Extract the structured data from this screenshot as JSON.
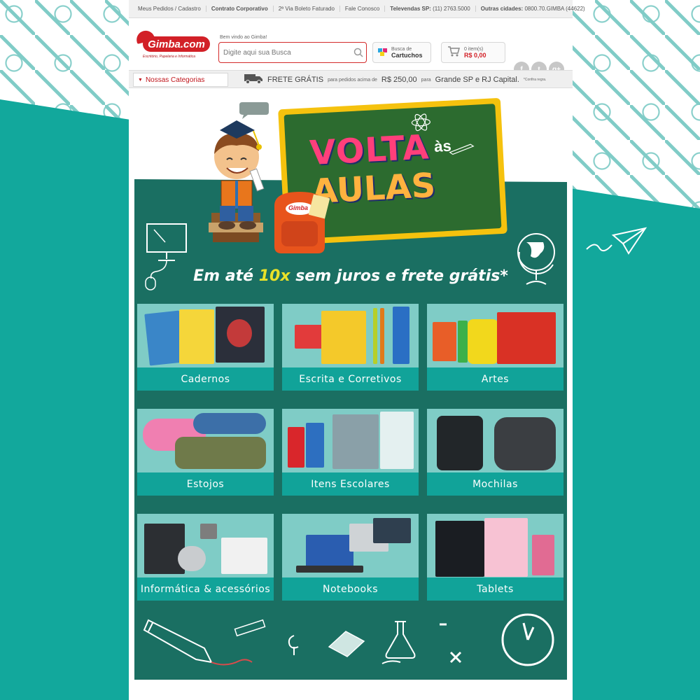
{
  "topbar": {
    "links": [
      "Meus Pedidos / Cadastro",
      "Contrato Corporativo",
      "2ª Via Boleto Faturado",
      "Fale Conosco"
    ],
    "televendas_label": "Televendas SP:",
    "televendas_number": "(11) 2763.5000",
    "outras_label": "Outras cidades:",
    "outras_number": "0800.70.GIMBA (44622)"
  },
  "header": {
    "logo_text": "Gimba.com",
    "logo_sub": "Escritório, Papelaria e Informática",
    "welcome": "Bem vindo ao Gimba!",
    "search_placeholder": "Digite aqui sua Busca",
    "cartridge_line1": "Busca de",
    "cartridge_line2": "Cartuchos",
    "cart_items": "0 item(s)",
    "cart_total": "R$ 0,00",
    "social": [
      "f",
      "t",
      "g+"
    ]
  },
  "nav": {
    "categories_label": "Nossas Categorias",
    "frete_big1": "FRETE GRÁTIS",
    "frete_small1": "para pedidos acima de",
    "frete_big2": "R$ 250,00",
    "frete_small2": "para",
    "frete_big3": "Grande SP e RJ Capital.",
    "frete_tiny": "*Confira regra."
  },
  "banner": {
    "volta": "VOLTA",
    "as": "às",
    "aulas": "AULAS",
    "backpack_logo": "Gimba",
    "promo_pre": "Em até",
    "promo_hl": "10x",
    "promo_post": "sem juros e frete grátis*"
  },
  "categories": [
    {
      "label": "Cadernos"
    },
    {
      "label": "Escrita e Corretivos"
    },
    {
      "label": "Artes"
    },
    {
      "label": "Estojos"
    },
    {
      "label": "Itens Escolares"
    },
    {
      "label": "Mochilas"
    },
    {
      "label": "Informática & acessórios"
    },
    {
      "label": "Notebooks"
    },
    {
      "label": "Tablets"
    }
  ],
  "colors": {
    "teal": "#12a89c",
    "dark_teal": "#1a6f62",
    "brand_red": "#d22027",
    "chalk_yellow": "#e9e229"
  }
}
